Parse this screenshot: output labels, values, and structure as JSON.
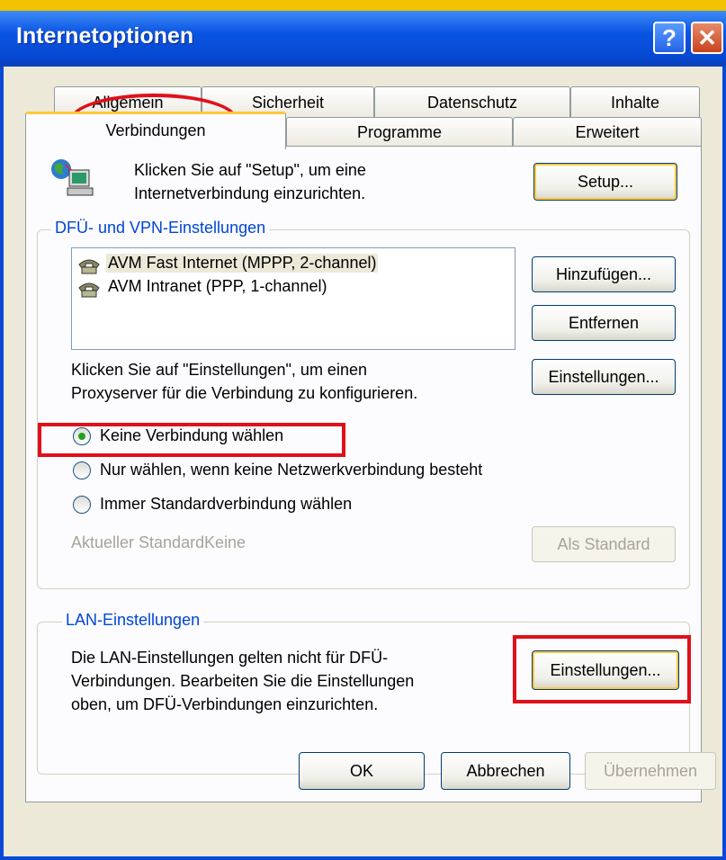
{
  "window": {
    "title": "Internetoptionen",
    "help_label": "?",
    "close_label": "✕"
  },
  "tabs_back": [
    "Allgemein",
    "Sicherheit",
    "Datenschutz",
    "Inhalte"
  ],
  "tabs_front": [
    "Verbindungen",
    "Programme",
    "Erweitert"
  ],
  "active_tab": "Verbindungen",
  "setup": {
    "text_line1": "Klicken Sie auf \"Setup\", um eine",
    "text_line2": "Internetverbindung einzurichten.",
    "button": "Setup..."
  },
  "dfu": {
    "group_label": "DFÜ- und VPN-Einstellungen",
    "connections": [
      "AVM Fast Internet (MPPP, 2-channel)",
      "AVM Intranet (PPP, 1-channel)"
    ],
    "add_button": "Hinzufügen...",
    "remove_button": "Entfernen",
    "settings_text_line1": "Klicken Sie auf \"Einstellungen\", um einen",
    "settings_text_line2": "Proxyserver für die Verbindung zu konfigurieren.",
    "settings_button": "Einstellungen...",
    "radio_options": [
      "Keine Verbindung wählen",
      "Nur wählen, wenn keine Netzwerkverbindung besteht",
      "Immer Standardverbindung wählen"
    ],
    "selected_option": "Keine Verbindung wählen",
    "current_default_label": "Aktueller Standard:",
    "current_default_value": "Keine",
    "set_default_button": "Als Standard"
  },
  "lan": {
    "group_label": "LAN-Einstellungen",
    "text_line1": "Die LAN-Einstellungen gelten nicht für DFÜ-",
    "text_line2": "Verbindungen. Bearbeiten Sie die Einstellungen",
    "text_line3": "oben, um DFÜ-Verbindungen einzurichten.",
    "settings_button": "Einstellungen..."
  },
  "footer": {
    "ok": "OK",
    "cancel": "Abbrechen",
    "apply": "Übernehmen"
  },
  "colors": {
    "titlebar": "#0a54e3",
    "dialog_bg": "#ece9d8",
    "group_label": "#0046d5",
    "highlight": "#e0101a",
    "tab_active_border": "#ffc83c"
  }
}
